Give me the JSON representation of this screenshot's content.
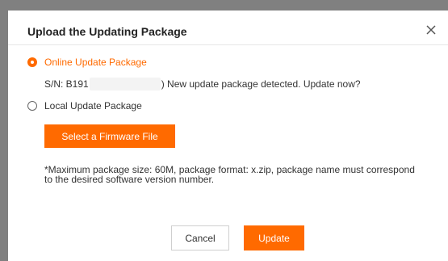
{
  "dialog": {
    "title": "Upload the Updating Package",
    "close_icon": "close-icon"
  },
  "options": {
    "online": {
      "label": "Online Update Package",
      "selected": true
    },
    "local": {
      "label": "Local Update Package",
      "selected": false
    }
  },
  "serial": {
    "prefix": "S/N: B191",
    "suffix": ") New update package detected. Update now?"
  },
  "firmware_button": "Select a Firmware File",
  "note": "*Maximum package size: 60M, package format: x.zip, package name must correspond to the desired software version number.",
  "footer": {
    "cancel_label": "Cancel",
    "update_label": "Update"
  },
  "colors": {
    "accent": "#ff6a00",
    "overlay": "#808080"
  }
}
